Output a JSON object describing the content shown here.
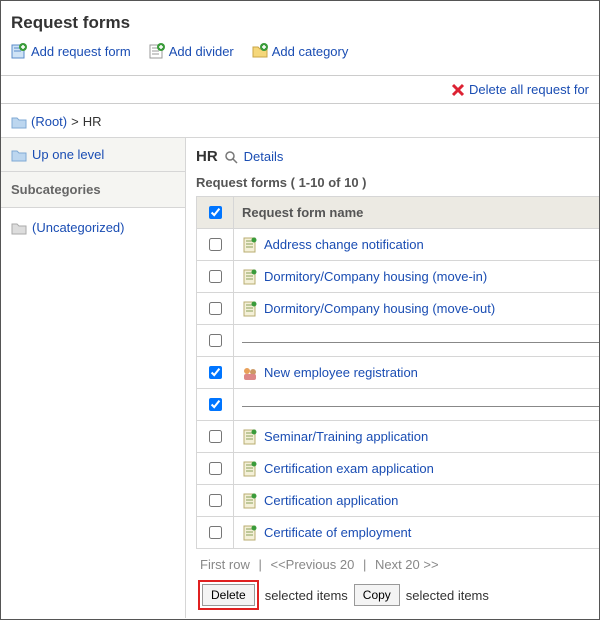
{
  "page_title": "Request forms",
  "toolbar": {
    "add_form": "Add request form",
    "add_divider": "Add divider",
    "add_category": "Add category"
  },
  "delete_all": "Delete all request for",
  "breadcrumb": {
    "root": "(Root)",
    "sep": ">",
    "current": "HR"
  },
  "sidebar": {
    "up": "Up one level",
    "subcat_header": "Subcategories",
    "uncategorized": "(Uncategorized)"
  },
  "content": {
    "category": "HR",
    "details": "Details",
    "list_header": "Request forms ( 1-10 of 10 )",
    "col_name": "Request form name",
    "rows": [
      {
        "name": "Address change notification",
        "checked": false,
        "blank": false,
        "special_icon": false
      },
      {
        "name": "Dormitory/Company housing (move-in)",
        "checked": false,
        "blank": false,
        "special_icon": false
      },
      {
        "name": "Dormitory/Company housing (move-out)",
        "checked": false,
        "blank": false,
        "special_icon": false
      },
      {
        "name": "",
        "checked": false,
        "blank": true,
        "special_icon": false
      },
      {
        "name": "New employee registration",
        "checked": true,
        "blank": false,
        "special_icon": true
      },
      {
        "name": "",
        "checked": true,
        "blank": true,
        "special_icon": false
      },
      {
        "name": "Seminar/Training application",
        "checked": false,
        "blank": false,
        "special_icon": false
      },
      {
        "name": "Certification exam application",
        "checked": false,
        "blank": false,
        "special_icon": false
      },
      {
        "name": "Certification application",
        "checked": false,
        "blank": false,
        "special_icon": false
      },
      {
        "name": "Certificate of employment",
        "checked": false,
        "blank": false,
        "special_icon": false
      }
    ]
  },
  "pager": {
    "first": "First row",
    "prev": "<<Previous 20",
    "next": "Next 20 >>"
  },
  "actions": {
    "delete": "Delete",
    "copy": "Copy",
    "suffix": "selected items"
  }
}
